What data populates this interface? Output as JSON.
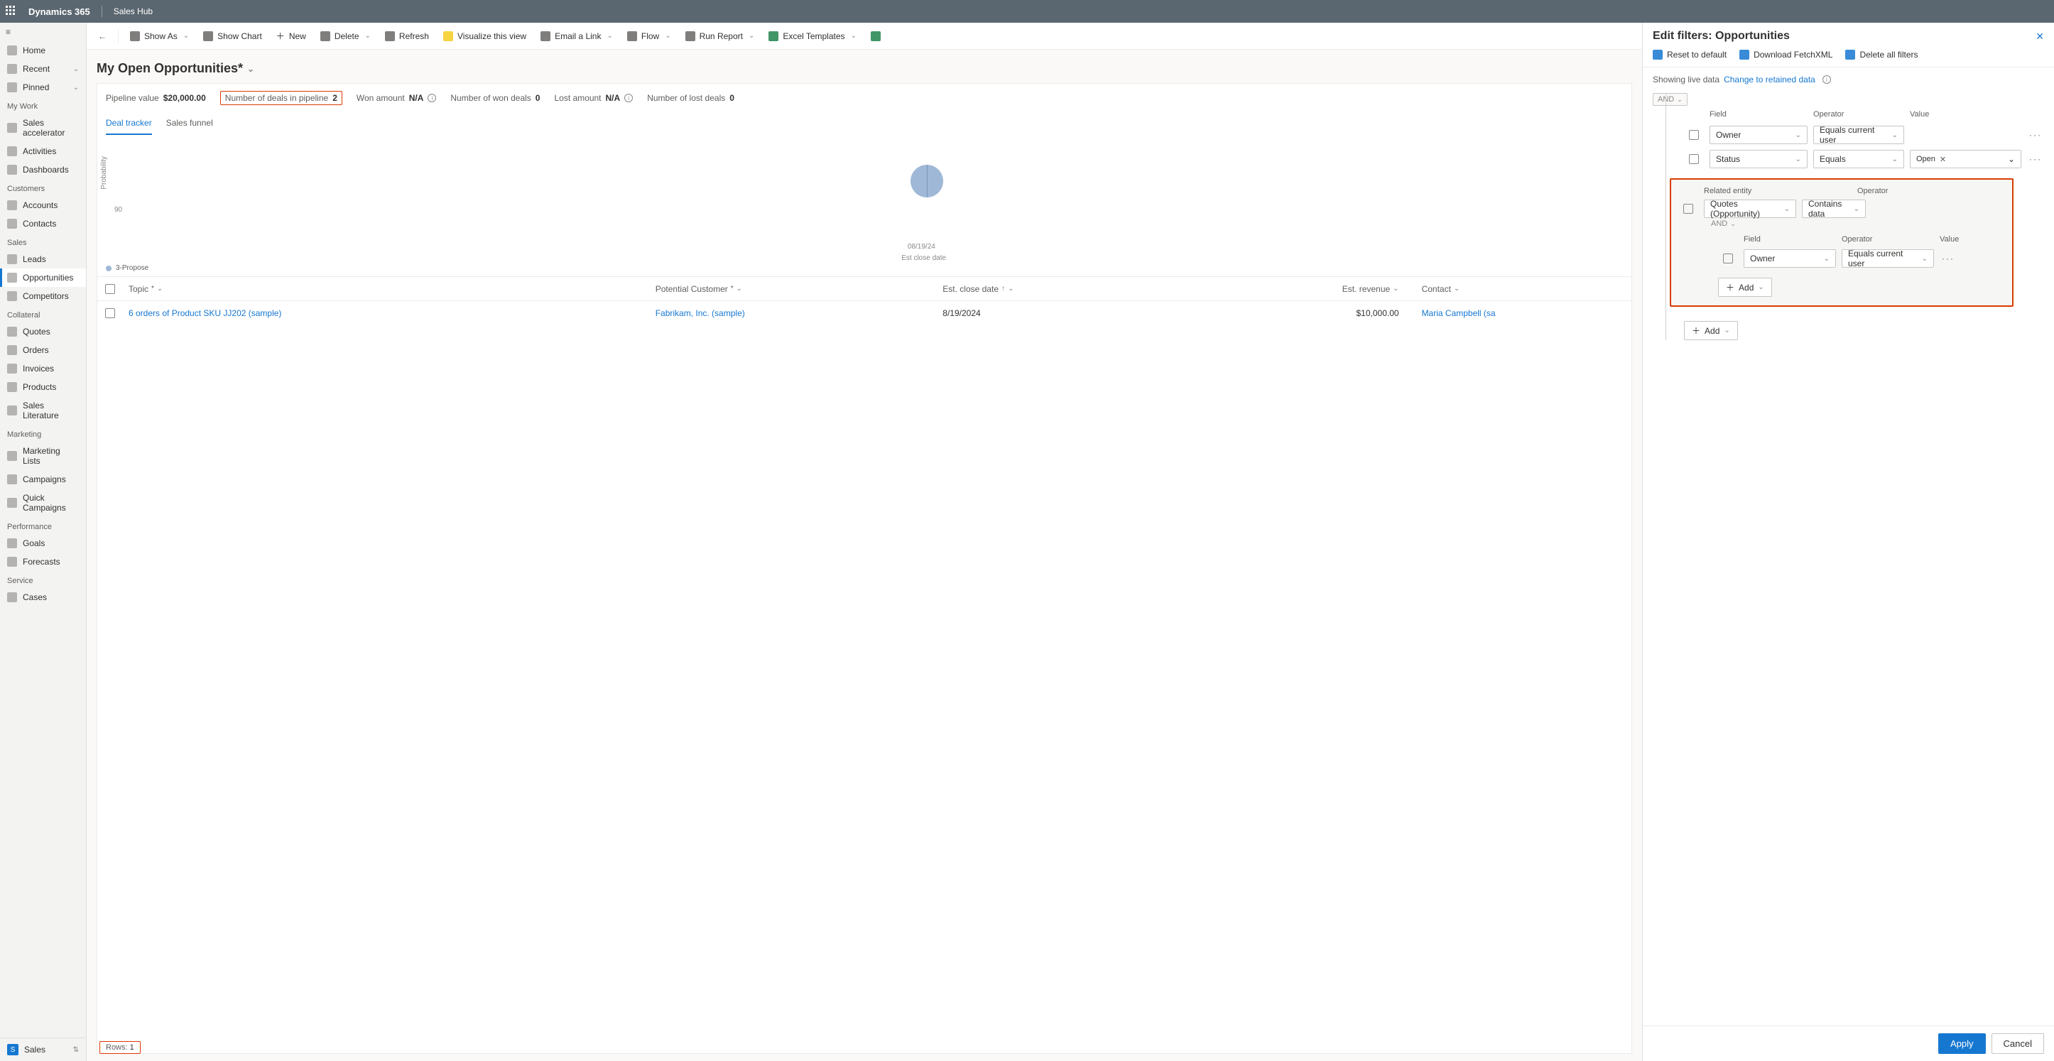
{
  "top": {
    "brand": "Dynamics 365",
    "app": "Sales Hub"
  },
  "nav": {
    "home": "Home",
    "recent": "Recent",
    "pinned": "Pinned",
    "mywork_h": "My Work",
    "sales_accel": "Sales accelerator",
    "activities": "Activities",
    "dashboards": "Dashboards",
    "customers_h": "Customers",
    "accounts": "Accounts",
    "contacts": "Contacts",
    "sales_h": "Sales",
    "leads": "Leads",
    "opportunities": "Opportunities",
    "competitors": "Competitors",
    "collateral_h": "Collateral",
    "quotes": "Quotes",
    "orders": "Orders",
    "invoices": "Invoices",
    "products": "Products",
    "saleslit": "Sales Literature",
    "marketing_h": "Marketing",
    "mlists": "Marketing Lists",
    "campaigns": "Campaigns",
    "qcampaigns": "Quick Campaigns",
    "performance_h": "Performance",
    "goals": "Goals",
    "forecasts": "Forecasts",
    "service_h": "Service",
    "cases": "Cases",
    "area": "Sales",
    "area_badge": "S"
  },
  "cmd": {
    "showas": "Show As",
    "showchart": "Show Chart",
    "new": "New",
    "delete": "Delete",
    "refresh": "Refresh",
    "visualize": "Visualize this view",
    "email": "Email a Link",
    "flow": "Flow",
    "runreport": "Run Report",
    "exceltmpl": "Excel Templates"
  },
  "view": {
    "title": "My Open Opportunities*"
  },
  "metrics": {
    "pipeline_l": "Pipeline value",
    "pipeline_v": "$20,000.00",
    "deals_l": "Number of deals in pipeline",
    "deals_v": "2",
    "won_l": "Won amount",
    "won_v": "N/A",
    "numwon_l": "Number of won deals",
    "numwon_v": "0",
    "lost_l": "Lost amount",
    "lost_v": "N/A",
    "numlost_l": "Number of lost deals",
    "numlost_v": "0"
  },
  "tabs": {
    "deal": "Deal tracker",
    "funnel": "Sales funnel"
  },
  "chart": {
    "ylabel": "Probability",
    "ytick": "90",
    "xtick": "08/19/24",
    "xlabel": "Est close date",
    "legend": "3-Propose"
  },
  "cols": {
    "topic": "Topic",
    "customer": "Potential Customer",
    "close": "Est. close date",
    "revenue": "Est. revenue",
    "contact": "Contact"
  },
  "row": {
    "topic": "6 orders of Product SKU JJ202 (sample)",
    "customer": "Fabrikam, Inc. (sample)",
    "close": "8/19/2024",
    "revenue": "$10,000.00",
    "contact": "Maria Campbell (sa"
  },
  "footer": {
    "rows_l": "Rows:",
    "rows_v": "1"
  },
  "panel": {
    "title": "Edit filters: Opportunities",
    "reset": "Reset to default",
    "fetch": "Download FetchXML",
    "delall": "Delete all filters",
    "live": "Showing live data",
    "change": "Change to retained data",
    "and": "AND",
    "h_field": "Field",
    "h_op": "Operator",
    "h_val": "Value",
    "f1_field": "Owner",
    "f1_op": "Equals current user",
    "f2_field": "Status",
    "f2_op": "Equals",
    "f2_val": "Open",
    "rel_h_entity": "Related entity",
    "rel_h_op": "Operator",
    "rel_entity": "Quotes (Opportunity)",
    "rel_op": "Contains data",
    "inner_f": "Owner",
    "inner_op": "Equals current user",
    "add": "Add",
    "apply": "Apply",
    "cancel": "Cancel"
  },
  "chart_data": {
    "type": "scatter",
    "title": "",
    "xlabel": "Est close date",
    "ylabel": "Probability",
    "series": [
      {
        "name": "3-Propose",
        "points": [
          {
            "x": "08/19/24",
            "y": 90
          }
        ]
      }
    ],
    "ylim": [
      0,
      100
    ]
  }
}
